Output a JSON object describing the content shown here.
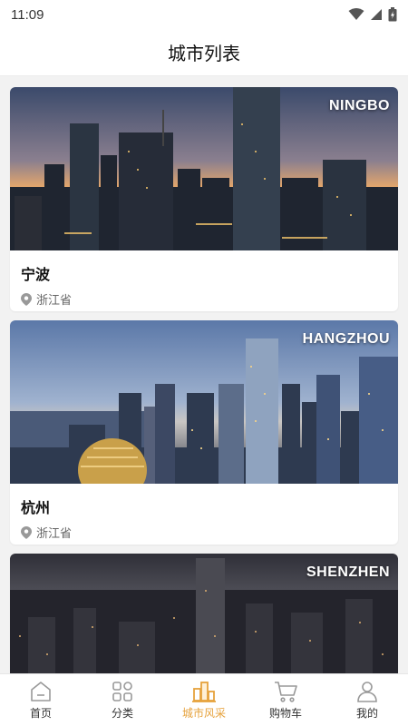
{
  "status_bar": {
    "time": "11:09",
    "icons": [
      "wifi-icon",
      "signal-icon",
      "battery-icon"
    ]
  },
  "header": {
    "title": "城市列表"
  },
  "cities": [
    {
      "name": "宁波",
      "name_en": "NINGBO",
      "province": "浙江省"
    },
    {
      "name": "杭州",
      "name_en": "HANGZHOU",
      "province": "浙江省"
    },
    {
      "name_en": "SHENZHEN"
    }
  ],
  "tab_bar": {
    "items": [
      {
        "label": "首页",
        "icon": "home-icon"
      },
      {
        "label": "分类",
        "icon": "category-grid-icon"
      },
      {
        "label": "城市风采",
        "icon": "city-buildings-icon",
        "active": true
      },
      {
        "label": "购物车",
        "icon": "cart-icon"
      },
      {
        "label": "我的",
        "icon": "user-icon"
      }
    ]
  },
  "colors": {
    "accent": "#e6a23c",
    "background": "#f2f2f2",
    "text": "#111111",
    "muted": "#666666"
  }
}
